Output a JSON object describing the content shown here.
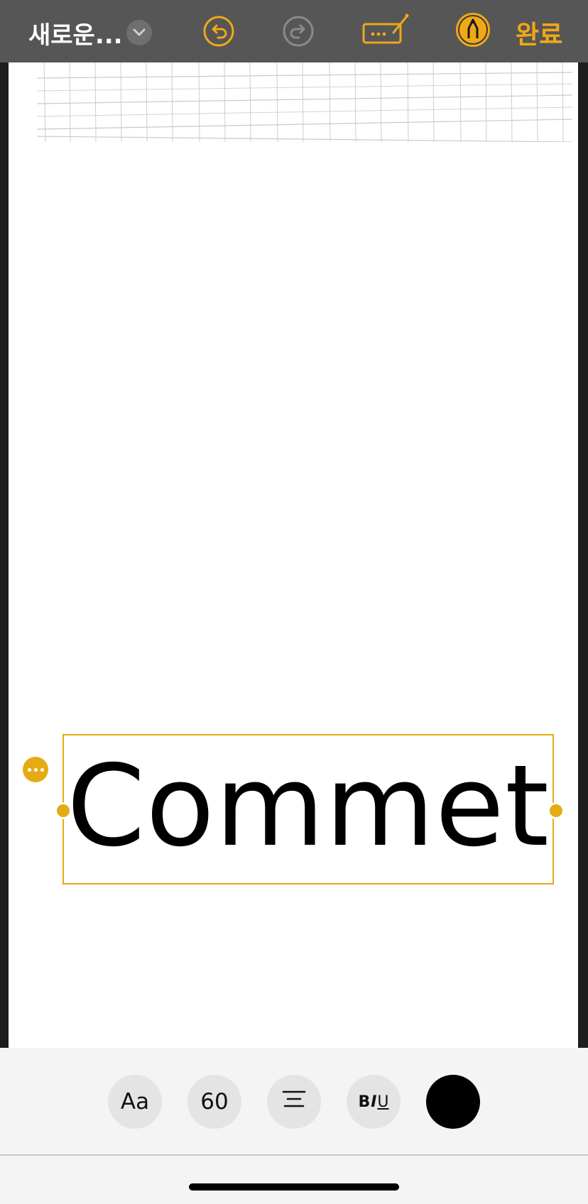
{
  "toolbar": {
    "title": "새로운...",
    "done_label": "완료",
    "icons": [
      "chevron-down-icon",
      "undo-icon",
      "redo-icon",
      "text-box-icon",
      "markup-pen-icon"
    ],
    "accent_color": "#f0a818",
    "background_color": "#565656"
  },
  "document": {
    "text_box_content": "Commet"
  },
  "format_bar": {
    "font_button": "Aa",
    "font_size": "60",
    "bold_glyph": "B",
    "italic_glyph": "I",
    "underline_glyph": "U",
    "selected_color": "#000000",
    "icons": [
      "align-center-icon",
      "more-dots-icon"
    ]
  }
}
